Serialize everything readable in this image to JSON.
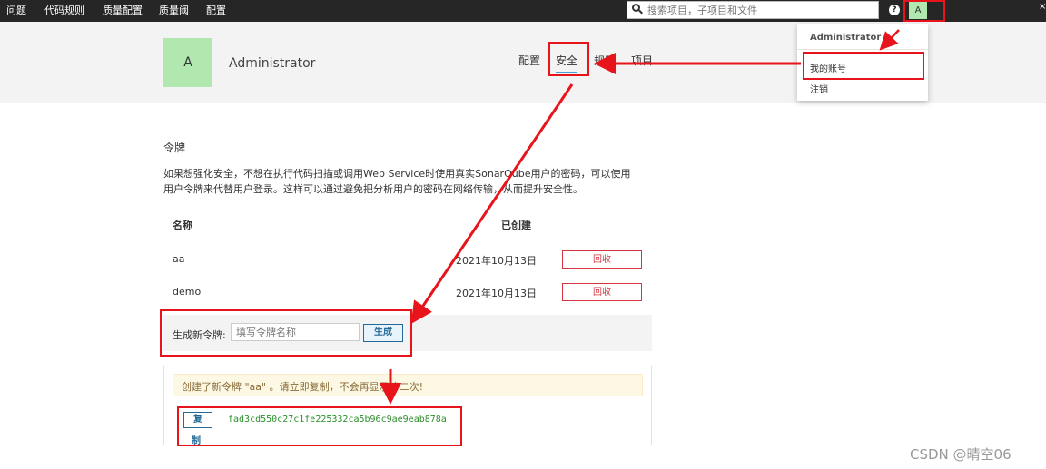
{
  "topnav": {
    "items": [
      {
        "label": "问题"
      },
      {
        "label": "代码规则"
      },
      {
        "label": "质量配置"
      },
      {
        "label": "质量阈"
      },
      {
        "label": "配置"
      }
    ],
    "search_placeholder": "搜索项目，子项目和文件",
    "help_icon": "?",
    "avatar_letter": "A",
    "corner_mark": "×"
  },
  "profile": {
    "avatar_letter": "A",
    "name": "Administrator",
    "tabs": [
      {
        "label": "配置",
        "active": false
      },
      {
        "label": "安全",
        "active": true
      },
      {
        "label": "规则",
        "active": false
      },
      {
        "label": "项目",
        "active": false
      }
    ]
  },
  "dropdown": {
    "header": "Administrator",
    "items": [
      {
        "label": "我的账号"
      },
      {
        "label": "注销"
      }
    ]
  },
  "tokens": {
    "title": "令牌",
    "description": "如果想强化安全，不想在执行代码扫描或调用Web Service时使用真实SonarQube用户的密码，可以使用用户令牌来代替用户登录。这样可以通过避免把分析用户的密码在网络传输，从而提升安全性。",
    "col_name": "名称",
    "col_created": "已创建",
    "rows": [
      {
        "name": "aa",
        "created": "2021年10月13日",
        "action": "回收"
      },
      {
        "name": "demo",
        "created": "2021年10月13日",
        "action": "回收"
      }
    ],
    "generate": {
      "label": "生成新令牌:",
      "placeholder": "填写令牌名称",
      "button": "生成"
    },
    "new_token": {
      "warning": "创建了新令牌 \"aa\" 。请立即复制，不会再显示第二次!",
      "copy_line1": "复",
      "copy_line2": "制",
      "value": "fad3cd550c27c1fe225332ca5b96c9ae9eab878a"
    }
  },
  "watermark": "CSDN @晴空06",
  "colors": {
    "topbar": "#262626",
    "accent": "#236a97",
    "danger": "#d4333f",
    "annotation": "#e8141c",
    "avatar_bg": "#b0e8b0",
    "token_green": "#2a8f2a"
  }
}
